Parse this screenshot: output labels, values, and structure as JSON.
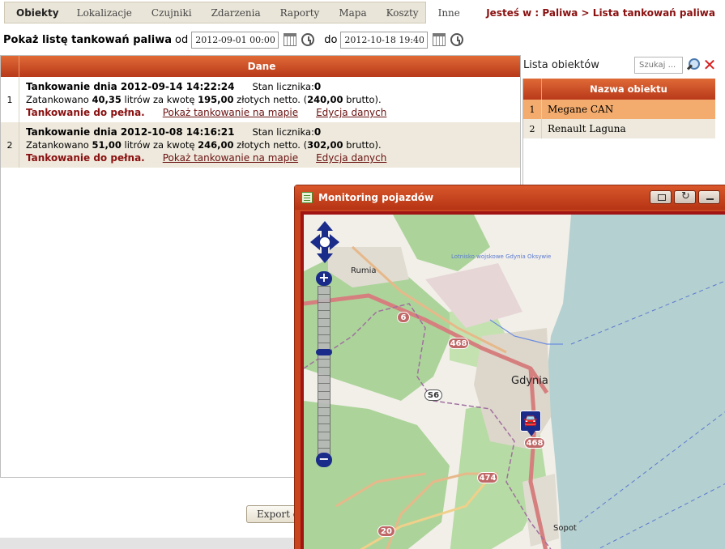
{
  "nav": {
    "items": [
      "Obiekty",
      "Lokalizacje",
      "Czujniki",
      "Zdarzenia",
      "Raporty",
      "Mapa",
      "Koszty",
      "Inne"
    ],
    "active": "Obiekty"
  },
  "breadcrumb": "Jesteś w : Paliwa > Lista tankowań paliwa",
  "filter": {
    "label": "Pokaż listę tankowań paliwa",
    "from_label": "od",
    "from_value": "2012-09-01 00:00",
    "to_label": "do",
    "to_value": "2012-10-18 19:40"
  },
  "grid": {
    "header": "Dane",
    "rows": [
      {
        "num": "1",
        "title": "Tankowanie dnia 2012-09-14 14:22:24",
        "counter_label": "Stan licznika:",
        "counter_value": "0",
        "detail_a": "Zatankowano ",
        "liters": "40,35",
        "detail_b": " litrów za kwotę ",
        "net": "195,00",
        "detail_c": " złotych netto. (",
        "gross": "240,00",
        "detail_d": " brutto).",
        "full": "Tankowanie do pełna.",
        "link_map": "Pokaż tankowanie na mapie",
        "link_edit": "Edycja danych"
      },
      {
        "num": "2",
        "title": "Tankowanie dnia 2012-10-08 14:16:21",
        "counter_label": "Stan licznika:",
        "counter_value": "0",
        "detail_a": "Zatankowano ",
        "liters": "51,00",
        "detail_b": " litrów za kwotę ",
        "net": "246,00",
        "detail_c": " złotych netto. (",
        "gross": "302,00",
        "detail_d": " brutto).",
        "full": "Tankowanie do pełna.",
        "link_map": "Pokaż tankowanie na mapie",
        "link_edit": "Edycja danych"
      }
    ]
  },
  "export_label": "Export d",
  "objects": {
    "title": "Lista obiektów",
    "search_placeholder": "Szukaj ...",
    "header": "Nazwa obiektu",
    "rows": [
      {
        "num": "1",
        "name": "Megane CAN",
        "selected": true
      },
      {
        "num": "2",
        "name": "Renault Laguna",
        "selected": false
      }
    ]
  },
  "map_window": {
    "title": "Monitoring pojazdów",
    "labels": {
      "rumia": "Rumia",
      "gdynia": "Gdynia",
      "sopot": "Sopot",
      "airport": "Lotnisko wojskowe Gdynia Oksywie"
    },
    "road_shields": [
      "6",
      "468",
      "S6",
      "468",
      "474",
      "20"
    ]
  },
  "colors": {
    "accent": "#c9451d",
    "link": "#6a1010",
    "selected_row": "#f4ac6e",
    "alt_row": "#eee9dc",
    "marker": "#1a2b8a"
  }
}
